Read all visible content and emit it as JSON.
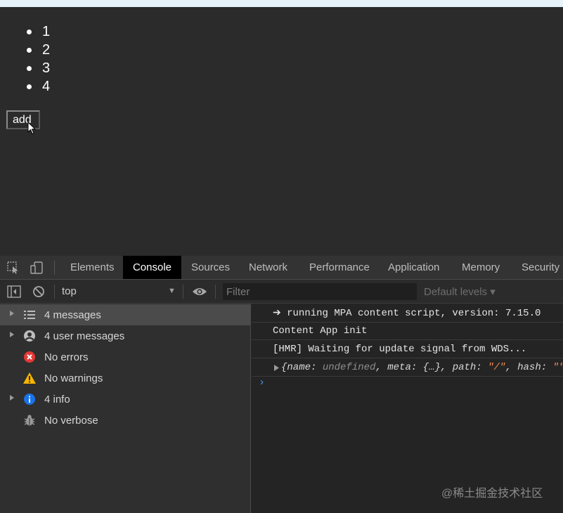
{
  "page": {
    "list_items": [
      "1",
      "2",
      "3",
      "4"
    ],
    "add_button_label": "add"
  },
  "devtools": {
    "tabs": [
      "Elements",
      "Console",
      "Sources",
      "Network",
      "Performance",
      "Application",
      "Memory",
      "Security"
    ],
    "active_tab": "Console",
    "toolbar": {
      "context": "top",
      "filter_placeholder": "Filter",
      "levels_label": "Default levels ▾"
    },
    "sidebar": [
      {
        "label": "4 messages",
        "icon": "list-icon"
      },
      {
        "label": "4 user messages",
        "icon": "user-icon"
      },
      {
        "label": "No errors",
        "icon": "error-icon"
      },
      {
        "label": "No warnings",
        "icon": "warning-icon"
      },
      {
        "label": "4 info",
        "icon": "info-icon"
      },
      {
        "label": "No verbose",
        "icon": "bug-icon"
      }
    ],
    "console": {
      "lines": [
        "➔ running MPA content script, version: 7.15.0",
        "Content App init",
        "[HMR] Waiting for update signal from WDS..."
      ],
      "object_parts": {
        "open": "{",
        "name_key": "name: ",
        "name_val": "undefined",
        "meta_key": ", meta: ",
        "meta_val": "{…}",
        "path_key": ", path: ",
        "path_val": "\"/\"",
        "hash_key": ", hash: ",
        "hash_val": "\"\","
      },
      "prompt": "›"
    }
  },
  "watermark": "@稀土掘金技术社区",
  "colors": {
    "page_bg": "#2b2b2b",
    "active_tab_bg": "#000000",
    "error": "#e53935",
    "warning": "#f4b400",
    "info": "#1a73e8",
    "string": "#f28b54"
  }
}
